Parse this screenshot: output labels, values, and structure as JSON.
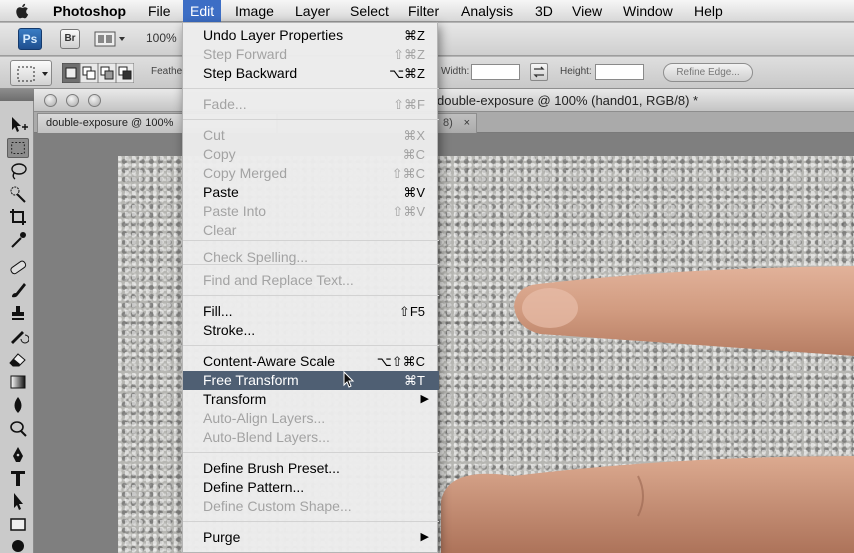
{
  "menubar": {
    "app_name": "Photoshop",
    "items": [
      "File",
      "Edit",
      "Image",
      "Layer",
      "Select",
      "Filter",
      "Analysis",
      "3D",
      "View",
      "Window",
      "Help"
    ]
  },
  "appbar": {
    "ps_logo": "Ps",
    "br_logo": "Br",
    "zoom": "100%"
  },
  "options": {
    "feather_label": "Feather",
    "width_label": "Width:",
    "height_label": "Height:",
    "refine_edge": "Refine Edge..."
  },
  "document": {
    "window_title": "double-exposure @ 100% (hand01, RGB/8) *",
    "tabs": [
      {
        "label": "double-exposure @ 100%",
        "close": "×"
      },
      {
        "label": "8)",
        "close": "×"
      }
    ]
  },
  "edit_menu": [
    {
      "label": "Undo Layer Properties",
      "shortcut": "⌘Z",
      "enabled": true
    },
    {
      "label": "Step Forward",
      "shortcut": "⇧⌘Z",
      "enabled": false
    },
    {
      "label": "Step Backward",
      "shortcut": "⌥⌘Z",
      "enabled": true
    },
    {
      "label": "Fade...",
      "shortcut": "⇧⌘F",
      "enabled": false
    },
    {
      "label": "Cut",
      "shortcut": "⌘X",
      "enabled": false
    },
    {
      "label": "Copy",
      "shortcut": "⌘C",
      "enabled": false
    },
    {
      "label": "Copy Merged",
      "shortcut": "⇧⌘C",
      "enabled": false
    },
    {
      "label": "Paste",
      "shortcut": "⌘V",
      "enabled": true
    },
    {
      "label": "Paste Into",
      "shortcut": "⇧⌘V",
      "enabled": false
    },
    {
      "label": "Clear",
      "shortcut": "",
      "enabled": false
    },
    {
      "label": "Check Spelling...",
      "shortcut": "",
      "enabled": false
    },
    {
      "label": "Find and Replace Text...",
      "shortcut": "",
      "enabled": false
    },
    {
      "label": "Fill...",
      "shortcut": "⇧F5",
      "enabled": true
    },
    {
      "label": "Stroke...",
      "shortcut": "",
      "enabled": true
    },
    {
      "label": "Content-Aware Scale",
      "shortcut": "⌥⇧⌘C",
      "enabled": true
    },
    {
      "label": "Free Transform",
      "shortcut": "⌘T",
      "enabled": true,
      "selected": true
    },
    {
      "label": "Transform",
      "shortcut": "",
      "enabled": true,
      "submenu": true
    },
    {
      "label": "Auto-Align Layers...",
      "shortcut": "",
      "enabled": false
    },
    {
      "label": "Auto-Blend Layers...",
      "shortcut": "",
      "enabled": false
    },
    {
      "label": "Define Brush Preset...",
      "shortcut": "",
      "enabled": true
    },
    {
      "label": "Define Pattern...",
      "shortcut": "",
      "enabled": true
    },
    {
      "label": "Define Custom Shape...",
      "shortcut": "",
      "enabled": false
    },
    {
      "label": "Purge",
      "shortcut": "",
      "enabled": true,
      "submenu": true
    }
  ],
  "colors": {
    "menu_highlight": "#3d6ec5",
    "item_selected": "#4f5f73",
    "disabled_text": "#a3a3a3",
    "skin": "#d8a58a"
  }
}
